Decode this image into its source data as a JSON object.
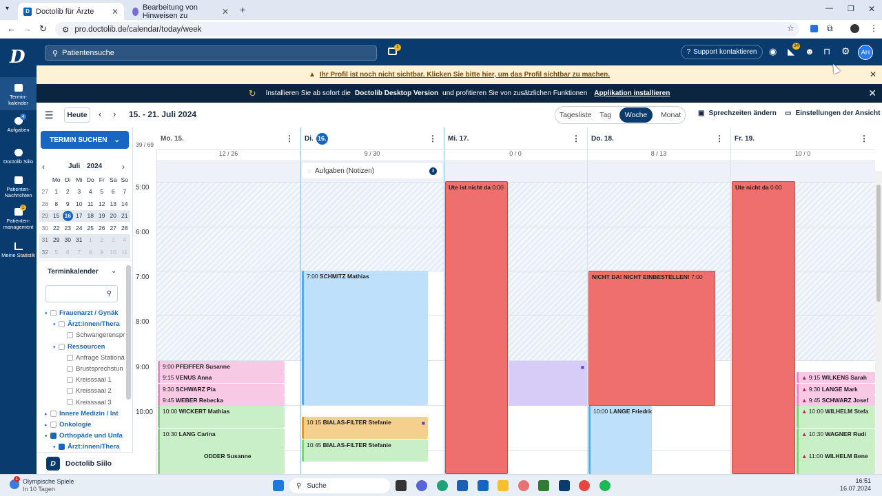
{
  "browser": {
    "tabs": [
      {
        "label": "Doctolib für Ärzte",
        "active": true
      },
      {
        "label": "Bearbeitung von Hinweisen zu",
        "active": false
      }
    ],
    "url": "pro.doctolib.de/calendar/today/week"
  },
  "header": {
    "search_placeholder": "Patientensuche",
    "support_label": "Support kontaktieren",
    "avatar": "AH",
    "inbox_badge": "1",
    "notif_badge": "34"
  },
  "sidebar": [
    {
      "label": "Termin-kalender",
      "icon": "calendar-icon"
    },
    {
      "label": "Aufgaben",
      "icon": "tasks-icon",
      "badge": "4"
    },
    {
      "label": "Doctolib Siilo",
      "icon": "chat-icon"
    },
    {
      "label": "Patienten-Nachrichten",
      "icon": "message-icon"
    },
    {
      "label": "Patienten-management",
      "icon": "patient-icon",
      "badge": "1"
    },
    {
      "label": "Meine Statistik",
      "icon": "stats-icon"
    }
  ],
  "warning": {
    "text": "Ihr Profil ist noch nicht sichtbar. Klicken Sie bitte hier, um das Profil sichtbar zu machen."
  },
  "promo": {
    "pre": "Installieren Sie ab sofort die",
    "bold": "Doctolib Desktop Version",
    "post": "und profitieren Sie von zusätzlichen Funktionen",
    "link": "Applikation installieren"
  },
  "toolbar": {
    "today": "Heute",
    "range": "15. - 21. Juli 2024",
    "views": [
      "Tagesliste",
      "Tag",
      "Woche",
      "Monat"
    ],
    "active_view": "Woche",
    "hours_label": "Sprechzeiten ändern",
    "settings_label": "Einstellungen der Ansicht"
  },
  "left": {
    "find_button": "TERMIN SUCHEN",
    "month": "Juli",
    "year": "2024",
    "weekdays": [
      "Mo",
      "Di",
      "Mi",
      "Do",
      "Fr",
      "Sa",
      "So"
    ],
    "weeks": [
      {
        "wk": "27",
        "days": [
          "1",
          "2",
          "3",
          "4",
          "5",
          "6",
          "7"
        ]
      },
      {
        "wk": "28",
        "days": [
          "8",
          "9",
          "10",
          "11",
          "12",
          "13",
          "14"
        ]
      },
      {
        "wk": "29",
        "days": [
          "15",
          "16",
          "17",
          "18",
          "19",
          "20",
          "21"
        ]
      },
      {
        "wk": "30",
        "days": [
          "22",
          "23",
          "24",
          "25",
          "26",
          "27",
          "28"
        ]
      },
      {
        "wk": "31",
        "days": [
          "29",
          "30",
          "31",
          "1",
          "2",
          "3",
          "4"
        ]
      },
      {
        "wk": "32",
        "days": [
          "5",
          "6",
          "7",
          "8",
          "9",
          "10",
          "11"
        ]
      }
    ],
    "calendars_title": "Terminkalender",
    "tree": [
      {
        "label": "Frauenarzt / Gynäk",
        "level": 0,
        "bold": true,
        "checked": false
      },
      {
        "label": "Ärzt:innen/Thera",
        "level": 1,
        "bold": true,
        "checked": false
      },
      {
        "label": "Schwangerenspr",
        "level": 2,
        "bold": false,
        "checked": false
      },
      {
        "label": "Ressourcen",
        "level": 1,
        "bold": true,
        "checked": false
      },
      {
        "label": "Anfrage Stationä",
        "level": 2,
        "bold": false,
        "checked": false
      },
      {
        "label": "Brustsprechstun",
        "level": 2,
        "bold": false,
        "checked": false
      },
      {
        "label": "Kreisssaal 1",
        "level": 2,
        "bold": false,
        "checked": false
      },
      {
        "label": "Kreisssaal 2",
        "level": 2,
        "bold": false,
        "checked": false
      },
      {
        "label": "Kreisssaal 3",
        "level": 2,
        "bold": false,
        "checked": false
      },
      {
        "label": "Innere Medizin / Int",
        "level": 0,
        "bold": true,
        "checked": false
      },
      {
        "label": "Onkologie",
        "level": 0,
        "bold": true,
        "checked": false
      },
      {
        "label": "Orthopäde und Unfa",
        "level": 0,
        "bold": true,
        "checked": true
      },
      {
        "label": "Ärzt:innen/Thera",
        "level": 1,
        "bold": true,
        "checked": true
      }
    ],
    "siilo": "Doctolib Siilo"
  },
  "calendar": {
    "total": "39 / 69",
    "tasks_label": "Aufgaben (Notizen)",
    "tasks_count": "3",
    "hours": [
      "5:00",
      "6:00",
      "7:00",
      "8:00",
      "9:00",
      "10:00"
    ],
    "days": [
      {
        "label": "Mo. 15.",
        "count": "12 / 26"
      },
      {
        "label": "Di.",
        "num": "16.",
        "count": "9 / 30"
      },
      {
        "label": "Mi. 17.",
        "count": "0 / 0"
      },
      {
        "label": "Do. 18.",
        "count": "8 / 13"
      },
      {
        "label": "Fr. 19.",
        "count": "10 / 0"
      }
    ],
    "events": {
      "mo1": {
        "time": "9:00",
        "name": "PFEIFFER Susanne"
      },
      "mo2": {
        "time": "9:15",
        "name": "VENUS Anna"
      },
      "mo3": {
        "time": "9:30",
        "name": "SCHWARZ Pia"
      },
      "mo4": {
        "time": "9:45",
        "name": "WEBER Rebecka"
      },
      "mo5": {
        "time": "10:00",
        "name": "WICKERT Mathias"
      },
      "mo6": {
        "time": "10:30",
        "name": "LANG Carina"
      },
      "mo7": {
        "time": "",
        "name": "ODDER Susanne"
      },
      "di1": {
        "time": "7:00",
        "name": "SCHMITZ Mathias"
      },
      "di2": {
        "time": "10:15",
        "name": "BIALAS-FILTER Stefanie"
      },
      "di3": {
        "time": "10:45",
        "name": "BIALAS-FILTER Stefanie"
      },
      "mi1": {
        "time": "0:00",
        "name": "Ute ist nicht da"
      },
      "do1": {
        "time": "7:00",
        "name": "NICHT DA! NICHT EINBESTELLEN!"
      },
      "do2": {
        "time": "10:00",
        "name": "LANGE Friedricl"
      },
      "fr1": {
        "time": "0:00",
        "name": "Ute nicht da"
      },
      "fr2": {
        "time": "9:15",
        "name": "WILKENS Sarah"
      },
      "fr3": {
        "time": "9:30",
        "name": "LANGE Mark"
      },
      "fr4": {
        "time": "9:45",
        "name": "SCHWARZ Josef"
      },
      "fr5": {
        "time": "10:00",
        "name": "WILHELM Stefa"
      },
      "fr6": {
        "time": "10:30",
        "name": "WAGNER Rudi"
      },
      "fr7": {
        "time": "11:00",
        "name": "WILHELM Bene"
      }
    }
  },
  "taskbar": {
    "weather_title": "Olympische Spiele",
    "weather_sub": "In 10 Tagen",
    "weather_badge": "1",
    "search": "Suche",
    "time": "16:51",
    "date": "16.07.2024"
  }
}
